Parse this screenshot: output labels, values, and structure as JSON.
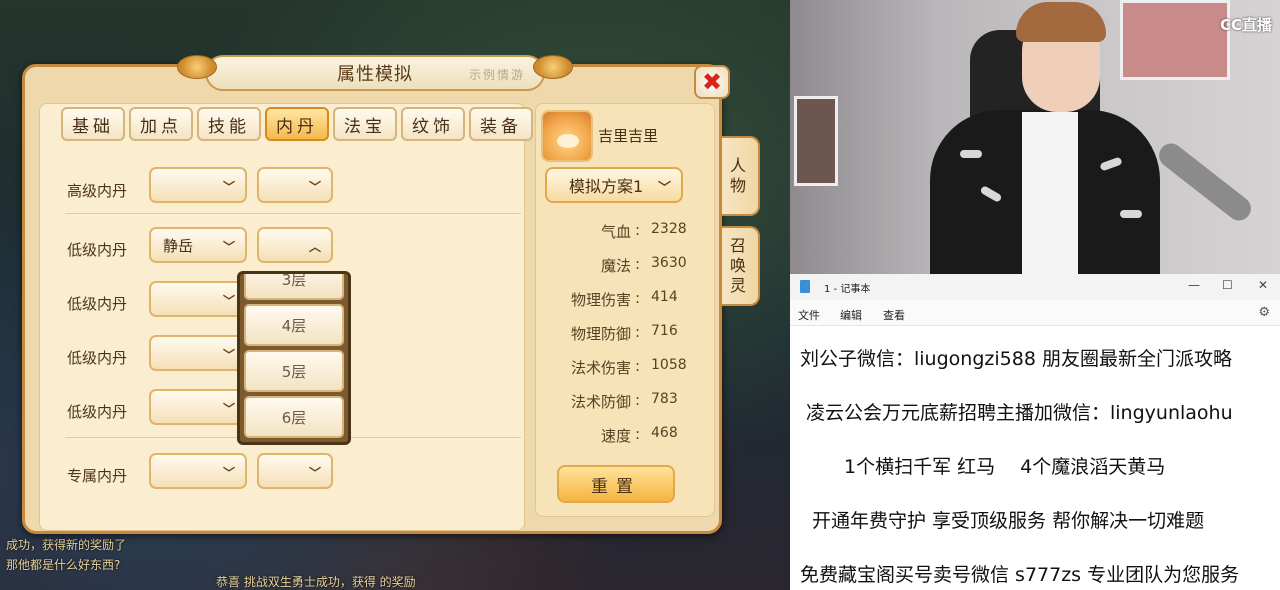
{
  "game": {
    "window_title": "属性模拟",
    "title_decoration": "示例情游",
    "tabs": [
      {
        "label": "基础",
        "active": false
      },
      {
        "label": "加点",
        "active": false
      },
      {
        "label": "技能",
        "active": false
      },
      {
        "label": "内丹",
        "active": true
      },
      {
        "label": "法宝",
        "active": false
      },
      {
        "label": "纹饰",
        "active": false
      },
      {
        "label": "装备",
        "active": false
      }
    ],
    "dan_rows": [
      {
        "label": "高级内丹",
        "value": ""
      },
      {
        "label": "低级内丹",
        "value": "静岳"
      },
      {
        "label": "低级内丹",
        "value": ""
      },
      {
        "label": "低级内丹",
        "value": ""
      },
      {
        "label": "低级内丹",
        "value": ""
      },
      {
        "label": "专属内丹",
        "value": ""
      }
    ],
    "layer_options": [
      "3层",
      "4层",
      "5层",
      "6层"
    ],
    "pet_name": "吉里吉里",
    "scheme": "模拟方案1",
    "stats": [
      {
        "label": "气血",
        "value": "2328"
      },
      {
        "label": "魔法",
        "value": "3630"
      },
      {
        "label": "物理伤害",
        "value": "414"
      },
      {
        "label": "物理防御",
        "value": "716"
      },
      {
        "label": "法术伤害",
        "value": "1058"
      },
      {
        "label": "法术防御",
        "value": "783"
      },
      {
        "label": "速度",
        "value": "468"
      }
    ],
    "reset_label": "重置",
    "side_tabs": [
      "人物",
      "召唤灵"
    ],
    "close_label": "✖",
    "background_chat": [
      "成功，获得新的奖励了",
      "那他都是什么好东西?",
      "恭喜 挑战双生勇士成功，获得 的奖励"
    ]
  },
  "stream": {
    "logo": "CC直播"
  },
  "notepad": {
    "title": "1 - 记事本",
    "menu": [
      "文件",
      "编辑",
      "查看"
    ],
    "lines": [
      "刘公子微信：liugongzi588 朋友圈最新全门派攻略",
      "凌云公会万元底薪招聘主播加微信：lingyunlaohu",
      "1个横扫千军 红马　 4个魔浪滔天黄马",
      "开通年费守护 享受顶级服务 帮你解决一切难题",
      "免费藏宝阁买号卖号微信 s777zs 专业团队为您服务"
    ]
  }
}
